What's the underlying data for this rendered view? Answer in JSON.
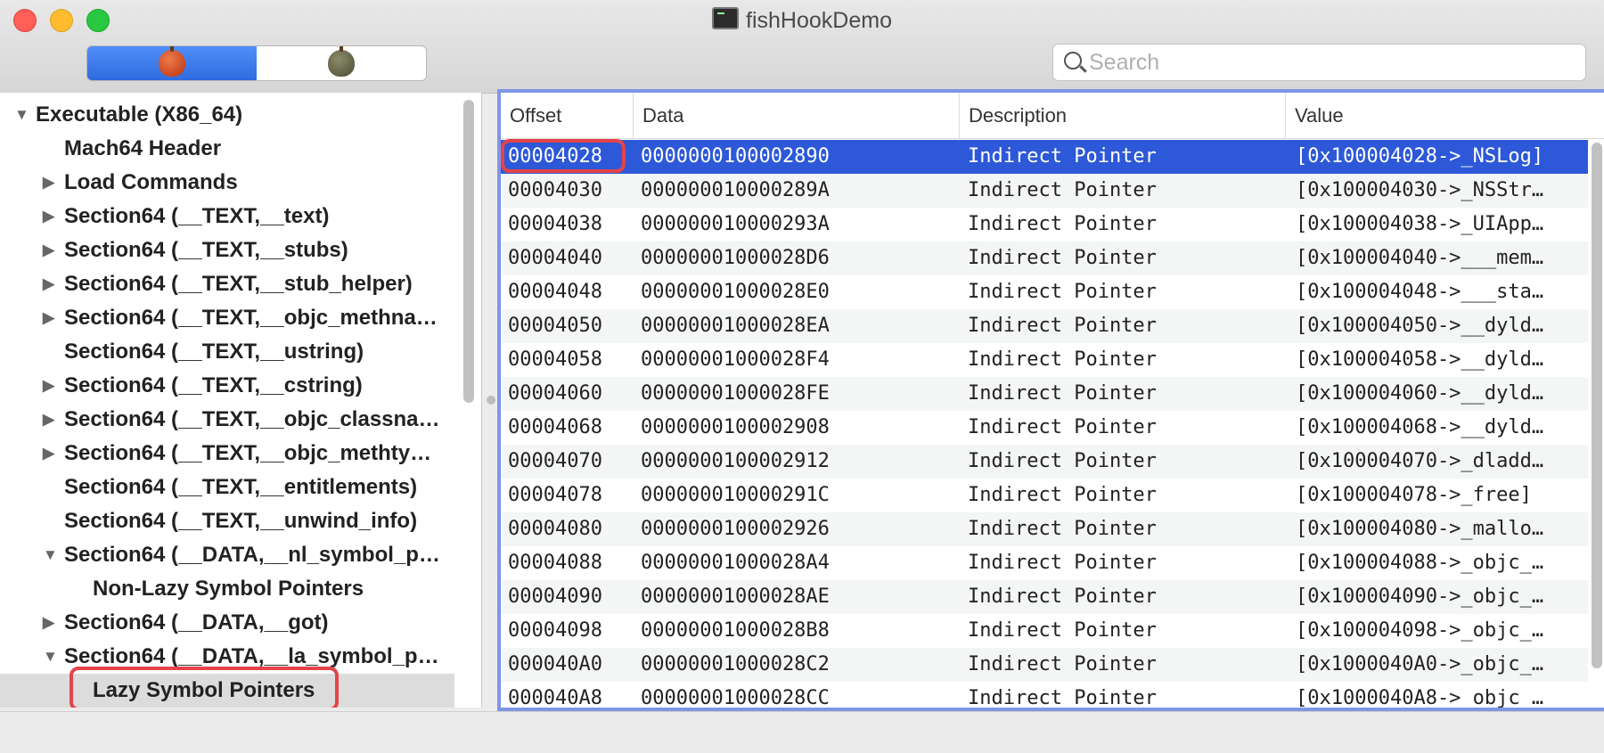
{
  "window": {
    "title": "fishHookDemo"
  },
  "toolbar": {
    "segments": [
      {
        "icon": "red-apple-icon",
        "active": true
      },
      {
        "icon": "gray-apple-icon",
        "active": false
      }
    ],
    "search_placeholder": "Search"
  },
  "outline": {
    "items": [
      {
        "label": "Executable  (X86_64)",
        "level": 0,
        "disclosure": "expanded"
      },
      {
        "label": "Mach64 Header",
        "level": 1,
        "disclosure": "none"
      },
      {
        "label": "Load Commands",
        "level": 1,
        "disclosure": "collapsed"
      },
      {
        "label": "Section64 (__TEXT,__text)",
        "level": 1,
        "disclosure": "collapsed"
      },
      {
        "label": "Section64 (__TEXT,__stubs)",
        "level": 1,
        "disclosure": "collapsed"
      },
      {
        "label": "Section64 (__TEXT,__stub_helper)",
        "level": 1,
        "disclosure": "collapsed"
      },
      {
        "label": "Section64 (__TEXT,__objc_methna…",
        "level": 1,
        "disclosure": "collapsed"
      },
      {
        "label": "Section64 (__TEXT,__ustring)",
        "level": 1,
        "disclosure": "none"
      },
      {
        "label": "Section64 (__TEXT,__cstring)",
        "level": 1,
        "disclosure": "collapsed"
      },
      {
        "label": "Section64 (__TEXT,__objc_classna…",
        "level": 1,
        "disclosure": "collapsed"
      },
      {
        "label": "Section64 (__TEXT,__objc_methty…",
        "level": 1,
        "disclosure": "collapsed"
      },
      {
        "label": "Section64 (__TEXT,__entitlements)",
        "level": 1,
        "disclosure": "none"
      },
      {
        "label": "Section64 (__TEXT,__unwind_info)",
        "level": 1,
        "disclosure": "none"
      },
      {
        "label": "Section64 (__DATA,__nl_symbol_p…",
        "level": 1,
        "disclosure": "expanded"
      },
      {
        "label": "Non-Lazy Symbol Pointers",
        "level": 2,
        "disclosure": "none"
      },
      {
        "label": "Section64 (__DATA,__got)",
        "level": 1,
        "disclosure": "collapsed"
      },
      {
        "label": "Section64 (__DATA,__la_symbol_p…",
        "level": 1,
        "disclosure": "expanded"
      },
      {
        "label": "Lazy Symbol Pointers",
        "level": 2,
        "disclosure": "none",
        "selected": true
      }
    ]
  },
  "table": {
    "columns": [
      "Offset",
      "Data",
      "Description",
      "Value"
    ],
    "rows": [
      {
        "offset": "00004028",
        "data": "0000000100002890",
        "description": "Indirect Pointer",
        "value": "[0x100004028->_NSLog]"
      },
      {
        "offset": "00004030",
        "data": "000000010000289A",
        "description": "Indirect Pointer",
        "value": "[0x100004030->_NSStr…"
      },
      {
        "offset": "00004038",
        "data": "000000010000293A",
        "description": "Indirect Pointer",
        "value": "[0x100004038->_UIApp…"
      },
      {
        "offset": "00004040",
        "data": "00000001000028D6",
        "description": "Indirect Pointer",
        "value": "[0x100004040->___mem…"
      },
      {
        "offset": "00004048",
        "data": "00000001000028E0",
        "description": "Indirect Pointer",
        "value": "[0x100004048->___sta…"
      },
      {
        "offset": "00004050",
        "data": "00000001000028EA",
        "description": "Indirect Pointer",
        "value": "[0x100004050->__dyld…"
      },
      {
        "offset": "00004058",
        "data": "00000001000028F4",
        "description": "Indirect Pointer",
        "value": "[0x100004058->__dyld…"
      },
      {
        "offset": "00004060",
        "data": "00000001000028FE",
        "description": "Indirect Pointer",
        "value": "[0x100004060->__dyld…"
      },
      {
        "offset": "00004068",
        "data": "0000000100002908",
        "description": "Indirect Pointer",
        "value": "[0x100004068->__dyld…"
      },
      {
        "offset": "00004070",
        "data": "0000000100002912",
        "description": "Indirect Pointer",
        "value": "[0x100004070->_dladd…"
      },
      {
        "offset": "00004078",
        "data": "000000010000291C",
        "description": "Indirect Pointer",
        "value": "[0x100004078->_free]"
      },
      {
        "offset": "00004080",
        "data": "0000000100002926",
        "description": "Indirect Pointer",
        "value": "[0x100004080->_mallo…"
      },
      {
        "offset": "00004088",
        "data": "00000001000028A4",
        "description": "Indirect Pointer",
        "value": "[0x100004088->_objc_…"
      },
      {
        "offset": "00004090",
        "data": "00000001000028AE",
        "description": "Indirect Pointer",
        "value": "[0x100004090->_objc_…"
      },
      {
        "offset": "00004098",
        "data": "00000001000028B8",
        "description": "Indirect Pointer",
        "value": "[0x100004098->_objc_…"
      },
      {
        "offset": "000040A0",
        "data": "00000001000028C2",
        "description": "Indirect Pointer",
        "value": "[0x1000040A0->_objc_…"
      },
      {
        "offset": "000040A8",
        "data": "00000001000028CC",
        "description": "Indirect Pointer",
        "value": "[0x1000040A8->_objc_…"
      }
    ],
    "selected_row": 0
  },
  "colors": {
    "selection": "#2d58d8",
    "highlight_box": "#e5434a",
    "panel_border": "#7f95e6"
  }
}
